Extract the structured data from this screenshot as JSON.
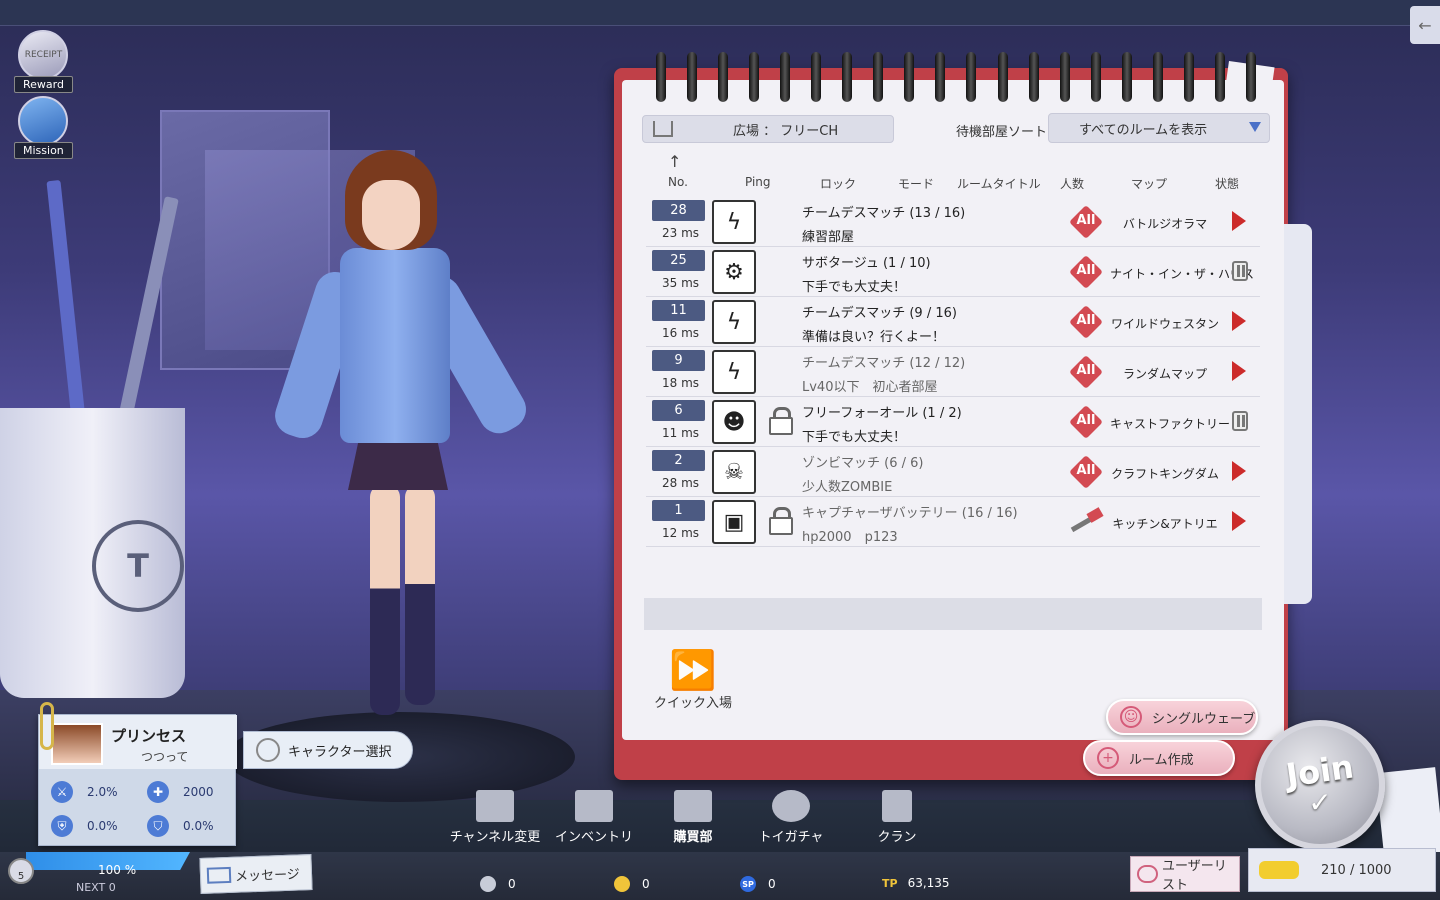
{
  "hud": {
    "reward_label": "Reward",
    "reward_badge": "RECEIPT",
    "mission_label": "Mission"
  },
  "channel": {
    "label": "広場 ： フリーCH"
  },
  "sort": {
    "label": "待機部屋ソート",
    "selected": "すべてのルームを表示"
  },
  "columns": [
    "No.",
    "Ping",
    "ロック",
    "モード",
    "ルームタイトル",
    "人数",
    "マップ",
    "状態"
  ],
  "rooms": [
    {
      "no": "28",
      "ping": "23 ms",
      "mode_icon": "bolt-icon",
      "locked": false,
      "title": "チームデスマッチ (13 / 16)",
      "subtitle": "練習部屋",
      "level": "All",
      "map": "バトルジオラマ",
      "state": "play",
      "muted": false
    },
    {
      "no": "25",
      "ping": "35 ms",
      "mode_icon": "support-icon",
      "locked": false,
      "title": "サボタージュ (1 / 10)",
      "subtitle": "下手でも大丈夫！",
      "level": "All",
      "map": "ナイト・イン・ザ・ハウス",
      "state": "pause",
      "muted": false
    },
    {
      "no": "11",
      "ping": "16 ms",
      "mode_icon": "bolt-icon",
      "locked": false,
      "title": "チームデスマッチ (9 / 16)",
      "subtitle": "準備は良い？行くよー！",
      "level": "All",
      "map": "ワイルドウェスタン",
      "state": "play",
      "muted": false
    },
    {
      "no": "9",
      "ping": "18 ms",
      "mode_icon": "bolt-icon",
      "locked": false,
      "title": "チームデスマッチ (12 / 12)",
      "subtitle": "Lv40以下　初心者部屋",
      "level": "All",
      "map": "ランダムマップ",
      "state": "play",
      "muted": true
    },
    {
      "no": "6",
      "ping": "11 ms",
      "mode_icon": "free-for-all-icon",
      "locked": true,
      "title": "フリーフォーオール (1 / 2)",
      "subtitle": "下手でも大丈夫！",
      "level": "All",
      "map": "キャストファクトリー",
      "state": "pause",
      "muted": false
    },
    {
      "no": "2",
      "ping": "28 ms",
      "mode_icon": "zombie-icon",
      "locked": false,
      "title": "ゾンビマッチ (6 / 6)",
      "subtitle": "少人数ZOMBIE",
      "level": "All",
      "map": "クラフトキングダム",
      "state": "play",
      "muted": true
    },
    {
      "no": "1",
      "ping": "12 ms",
      "mode_icon": "battery-icon",
      "locked": true,
      "title": "キャプチャーザバッテリー (16 / 16)",
      "subtitle": "hp2000　p123",
      "level": "hammer",
      "map": "キッチン&アトリエ",
      "state": "play",
      "muted": true
    }
  ],
  "quick_entry": "クイック入場",
  "single_wave": "シングルウェーブ",
  "create_room": "ルーム作成",
  "join": "Join",
  "profile": {
    "name": "プリンセス",
    "subtitle": "つつって",
    "stats": [
      {
        "icon": "attack-icon",
        "value": "2.0%"
      },
      {
        "icon": "hp-icon",
        "value": "2000"
      },
      {
        "icon": "defense-icon",
        "value": "0.0%"
      },
      {
        "icon": "shield-icon",
        "value": "0.0%"
      }
    ]
  },
  "character_select": "キャラクター選択",
  "nav": [
    {
      "icon": "channel-icon",
      "label": "チャンネル変更"
    },
    {
      "icon": "folder-icon",
      "label": "インベントリ"
    },
    {
      "icon": "cart-icon",
      "label": "購買部"
    },
    {
      "icon": "gacha-icon",
      "label": "トイガチャ"
    },
    {
      "icon": "flag-icon",
      "label": "クラン"
    }
  ],
  "footer": {
    "level": "5",
    "exp": "100 %",
    "next": "NEXT 0",
    "message": "メッセージ",
    "currency": [
      {
        "icon": "coin-icon",
        "value": "0"
      },
      {
        "icon": "medal-icon",
        "value": "0"
      },
      {
        "icon": "sp-icon",
        "value": "0",
        "tag": "SP"
      },
      {
        "icon": "tp-icon",
        "value": "63,135",
        "tag": "TP"
      }
    ],
    "user_list": "ユーザーリスト",
    "tp_text": "210 /  1000"
  },
  "colors": {
    "accent": "#cc2b2b",
    "number_badge": "#4c5a82",
    "notebook": "#c04048",
    "exp_bar": "#2f8ee8"
  }
}
